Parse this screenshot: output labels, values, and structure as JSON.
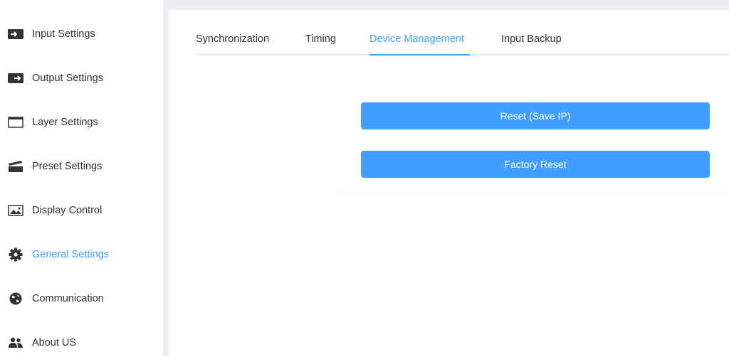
{
  "sidebar": {
    "items": [
      {
        "label": "Input Settings",
        "icon": "input-icon"
      },
      {
        "label": "Output Settings",
        "icon": "output-icon"
      },
      {
        "label": "Layer Settings",
        "icon": "window-icon"
      },
      {
        "label": "Preset Settings",
        "icon": "clapperboard-icon"
      },
      {
        "label": "Display Control",
        "icon": "image-icon"
      },
      {
        "label": "General Settings",
        "icon": "gear-icon",
        "active": true
      },
      {
        "label": "Communication",
        "icon": "globe-icon"
      },
      {
        "label": "About US",
        "icon": "users-icon"
      }
    ]
  },
  "tabs": [
    {
      "label": "Synchronization"
    },
    {
      "label": "Timing"
    },
    {
      "label": "Device Management",
      "active": true
    },
    {
      "label": "Input Backup"
    }
  ],
  "actions": {
    "reset_save_ip": "Reset (Save IP)",
    "factory_reset": "Factory Reset"
  },
  "colors": {
    "accent": "#409eff",
    "text": "#303133",
    "frame": "#eaedf1"
  }
}
